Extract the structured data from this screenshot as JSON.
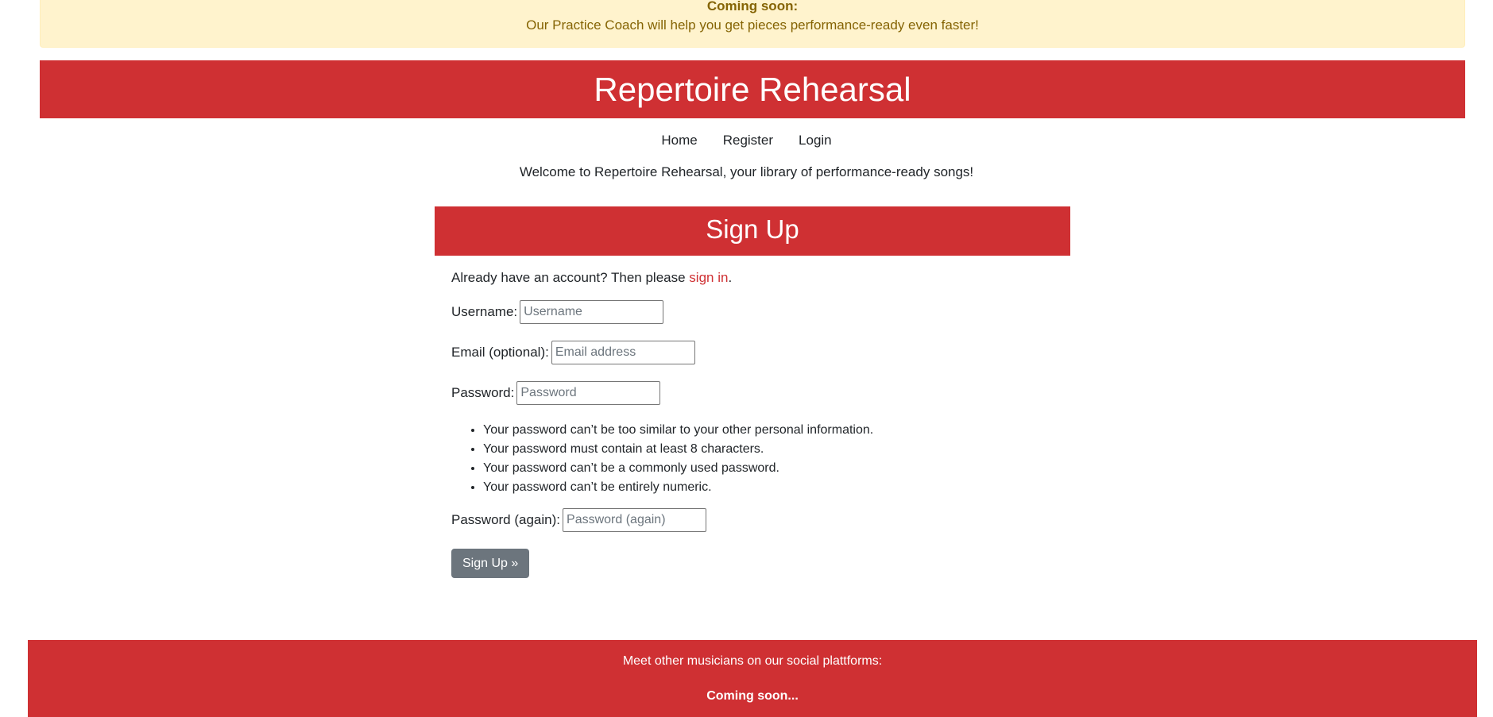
{
  "banner": {
    "heading": "Coming soon:",
    "text": "Our Practice Coach will help you get pieces performance-ready even faster!"
  },
  "header": {
    "title": "Repertoire Rehearsal"
  },
  "nav": {
    "items": [
      {
        "label": "Home"
      },
      {
        "label": "Register"
      },
      {
        "label": "Login"
      }
    ]
  },
  "welcome": "Welcome to Repertoire Rehearsal, your library of performance-ready songs!",
  "signup": {
    "title": "Sign Up",
    "already_prefix": "Already have an account? Then please ",
    "signin_link": "sign in",
    "already_suffix": ".",
    "fields": {
      "username": {
        "label": "Username:",
        "placeholder": "Username",
        "value": ""
      },
      "email": {
        "label": "Email (optional):",
        "placeholder": "Email address",
        "value": ""
      },
      "password": {
        "label": "Password:",
        "placeholder": "Password",
        "value": ""
      },
      "password2": {
        "label": "Password (again):",
        "placeholder": "Password (again)",
        "value": ""
      }
    },
    "password_help": [
      "Your password can’t be too similar to your other personal information.",
      "Your password must contain at least 8 characters.",
      "Your password can’t be a commonly used password.",
      "Your password can’t be entirely numeric."
    ],
    "submit_label": "Sign Up »"
  },
  "footer": {
    "text": "Meet other musicians on our social plattforms:",
    "coming": "Coming soon..."
  },
  "colors": {
    "brand_red": "#cf3033",
    "banner_bg": "#fff3cd",
    "banner_text": "#856404",
    "button_gray": "#6c757d"
  }
}
